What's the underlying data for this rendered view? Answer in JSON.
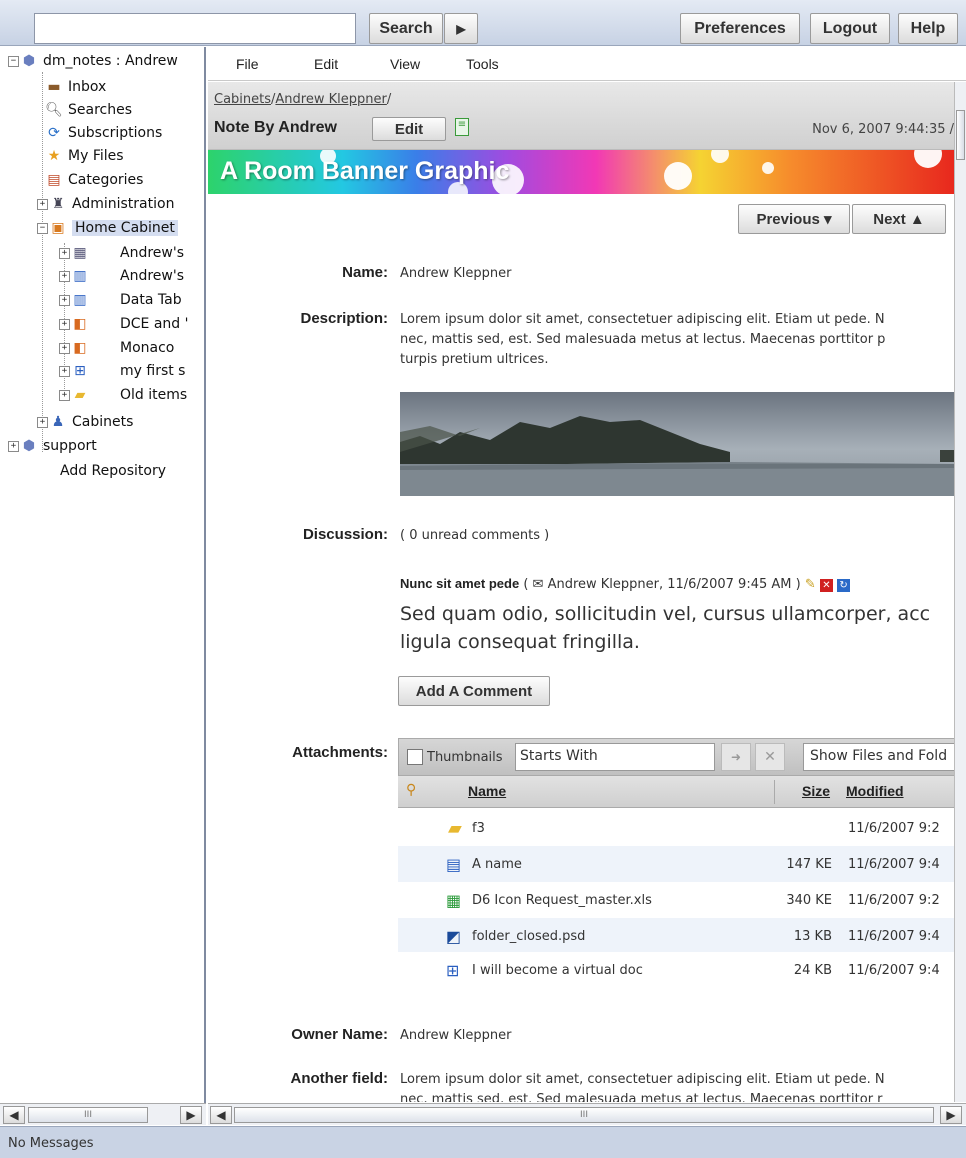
{
  "topbar": {
    "search_value": "",
    "search_button": "Search",
    "go_icon": "play-arrow-icon",
    "preferences": "Preferences",
    "logout": "Logout",
    "help": "Help"
  },
  "sidebar": {
    "repo": "dm_notes : Andrew",
    "items": {
      "inbox": "Inbox",
      "searches": "Searches",
      "subscriptions": "Subscriptions",
      "myfiles": "My Files",
      "categories": "Categories",
      "administration": "Administration",
      "home_cabinet": "Home Cabinet",
      "andrews1": "Andrew's",
      "andrews2": "Andrew's",
      "datatab": "Data Tab",
      "dce": "DCE and '",
      "monaco": "Monaco",
      "myfirst": "my first s",
      "olditems": "Old items",
      "cabinets": "Cabinets",
      "support": "support",
      "add_repo": "Add Repository"
    }
  },
  "menubar": {
    "file": "File",
    "edit": "Edit",
    "view": "View",
    "tools": "Tools"
  },
  "header": {
    "crumb1": "Cabinets",
    "sep1": "/",
    "crumb2": "Andrew Kleppner",
    "sep2": "/",
    "title": "Note By Andrew",
    "edit": "Edit",
    "timestamp": "Nov 6, 2007 9:44:35 /"
  },
  "banner": {
    "text": "A Room Banner Graphic"
  },
  "nav": {
    "previous": "Previous ▾",
    "next": "Next ▲"
  },
  "fields": {
    "name_label": "Name:",
    "name_value": "Andrew Kleppner",
    "desc_label": "Description:",
    "desc_line1": "Lorem ipsum dolor sit amet, consectetuer adipiscing elit. Etiam ut pede. N",
    "desc_line2": "nec, mattis sed, est. Sed malesuada metus at lectus. Maecenas porttitor p",
    "desc_line3": "turpis pretium ultrices.",
    "discussion_label": "Discussion:",
    "discussion_value": "( 0 unread comments )",
    "comment_title": "Nunc sit amet pede",
    "comment_meta": "( ✉ Andrew Kleppner, 11/6/2007 9:45 AM )",
    "comment_body1": "Sed quam odio, sollicitudin vel, cursus ullamcorper, acc",
    "comment_body2": "ligula consequat fringilla.",
    "add_comment": "Add A Comment",
    "attachments_label": "Attachments:",
    "owner_label": "Owner Name:",
    "owner_value": "Andrew Kleppner",
    "another_label": "Another field:",
    "another_line1": "Lorem ipsum dolor sit amet, consectetuer adipiscing elit. Etiam ut pede. N",
    "another_line2": "nec, mattis sed, est. Sed malesuada metus at lectus. Maecenas porttitor r"
  },
  "attachments": {
    "thumbnails_label": "Thumbnails",
    "filter_value": "Starts With",
    "show_select": "Show Files and Fold",
    "col_name": "Name",
    "col_size": "Size",
    "col_modified": "Modified",
    "rows": [
      {
        "icon": "folder-icon",
        "name": "f3",
        "size": "",
        "modified": "11/6/2007 9:2"
      },
      {
        "icon": "word-doc-icon",
        "name": "A name",
        "size": "147 KE",
        "modified": "11/6/2007 9:4"
      },
      {
        "icon": "excel-doc-icon",
        "name": "D6 Icon Request_master.xls",
        "size": "340 KE",
        "modified": "11/6/2007 9:2"
      },
      {
        "icon": "psd-file-icon",
        "name": "folder_closed.psd",
        "size": "13 KB",
        "modified": "11/6/2007 9:4"
      },
      {
        "icon": "virtual-doc-icon",
        "name": "I will become a virtual doc",
        "size": "24 KB",
        "modified": "11/6/2007 9:4"
      }
    ]
  },
  "status": {
    "text": "No Messages"
  },
  "scroll": {
    "thumb_mark": "III"
  }
}
